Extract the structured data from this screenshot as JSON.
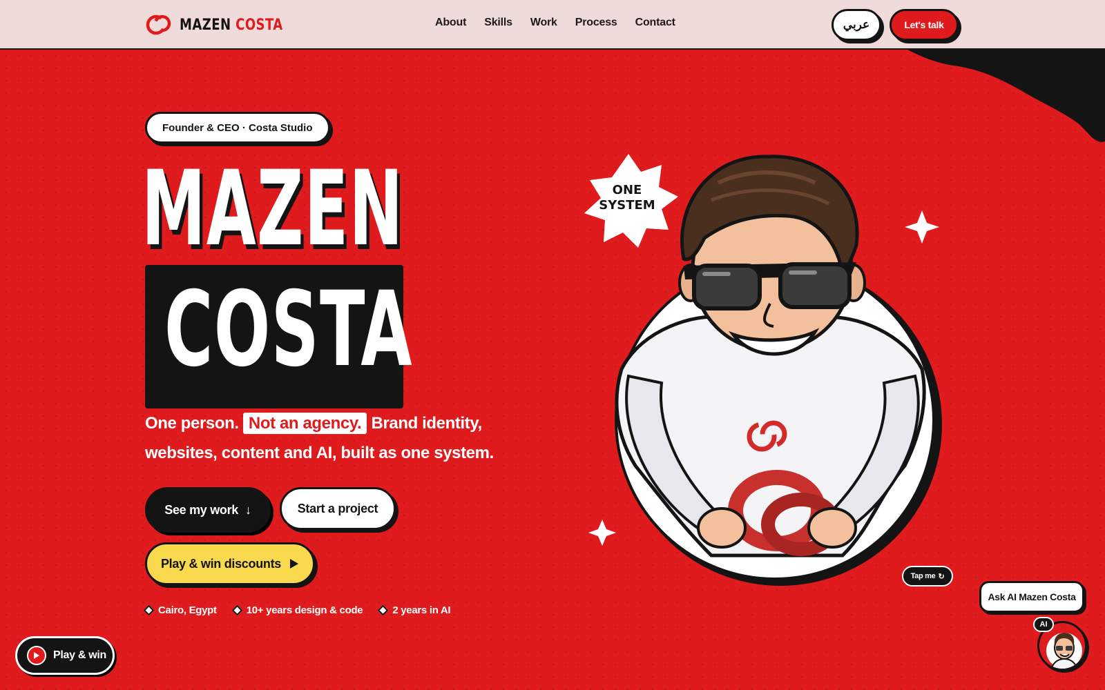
{
  "header": {
    "logo_first": "MAZEN",
    "logo_second": "COSTA",
    "nav": [
      "About",
      "Skills",
      "Work",
      "Process",
      "Contact"
    ],
    "lang_button": "عربي",
    "cta_button": "Let's talk"
  },
  "hero": {
    "badge": "Founder & CEO · Costa Studio",
    "name_first": "MAZEN",
    "name_second": "COSTA",
    "tagline_before": "One person.",
    "tagline_highlight": "Not an agency.",
    "tagline_after": "Brand identity, websites, content and AI, built as one system.",
    "btn_work": "See my work",
    "btn_work_icon": "↓",
    "btn_project": "Start a project",
    "btn_play": "Play & win discounts",
    "facts": [
      "Cairo, Egypt",
      "10+ years design & code",
      "2 years in AI"
    ]
  },
  "portrait": {
    "sticker_line1": "ONE",
    "sticker_line2": "SYSTEM",
    "tap_label": "Tap me",
    "tap_icon": "↻"
  },
  "floating": {
    "play_label": "Play & win",
    "ask_ai_label": "Ask AI Mazen Costa",
    "ai_tag": "AI"
  },
  "colors": {
    "brand_red": "#e01b1e",
    "ink": "#141414",
    "header_bg": "#efdcda",
    "accent_yellow": "#f9d94e"
  }
}
